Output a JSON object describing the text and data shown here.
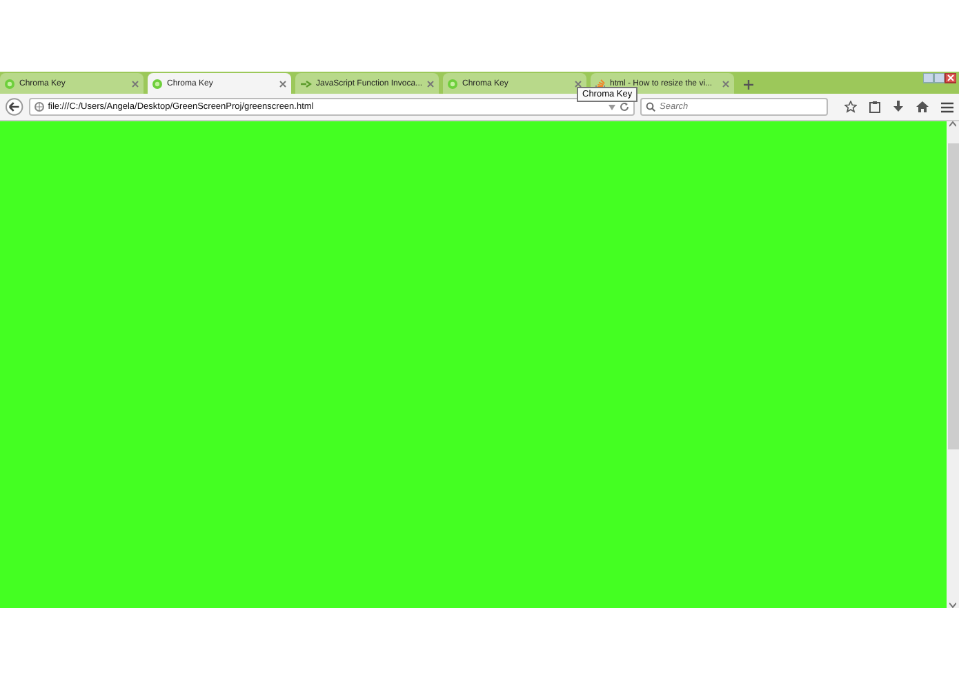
{
  "tabs": [
    {
      "title": "Chroma Key",
      "selected": false,
      "kind": "globe"
    },
    {
      "title": "Chroma Key",
      "selected": true,
      "kind": "globe"
    },
    {
      "title": "JavaScript Function Invoca...",
      "selected": false,
      "kind": "code"
    },
    {
      "title": "Chroma Key",
      "selected": false,
      "kind": "globe"
    },
    {
      "title": "html - How to resize the vi...",
      "selected": false,
      "kind": "stack"
    }
  ],
  "tooltip": "Chroma Key",
  "address": "file:///C:/Users/Angela/Desktop/GreenScreenProj/greenscreen.html",
  "search": {
    "placeholder": "Search"
  }
}
